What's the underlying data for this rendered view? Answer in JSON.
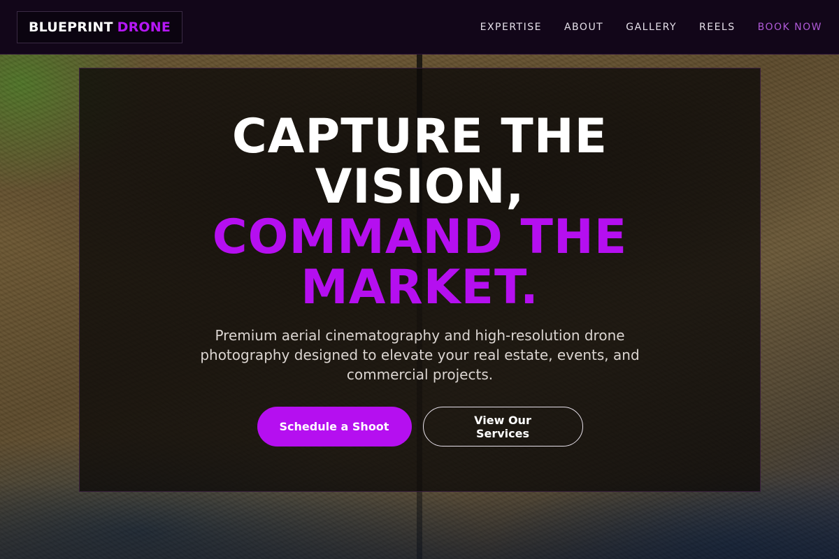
{
  "nav": {
    "logo_primary": "BLUEPRINT",
    "logo_accent": "DRONE",
    "links": [
      "EXPERTISE",
      "ABOUT",
      "GALLERY",
      "REELS"
    ],
    "cta": "BOOK NOW"
  },
  "hero": {
    "headline_line1": "CAPTURE THE VISION,",
    "headline_line2": "COMMAND THE MARKET.",
    "subtitle": "Premium aerial cinematography and high-resolution drone photography designed to elevate your real estate, events, and commercial projects.",
    "primary_button": "Schedule a Shoot",
    "secondary_button": "View Our Services"
  },
  "colors": {
    "accent": "#b50ff0",
    "nav_background": "#120619",
    "text": "#ffffff"
  }
}
